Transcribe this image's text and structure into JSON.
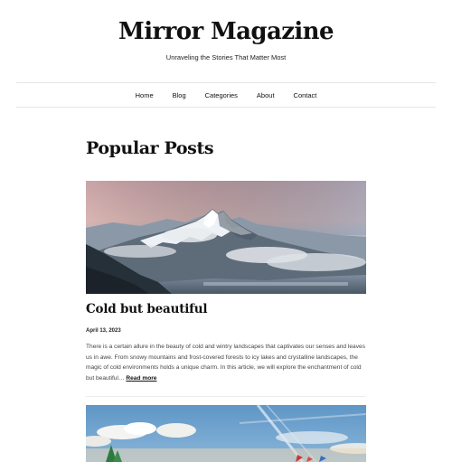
{
  "site": {
    "title": "Mirror Magazine",
    "tagline": "Unraveling the Stories That Matter Most"
  },
  "nav": {
    "items": [
      {
        "label": "Home"
      },
      {
        "label": "Blog"
      },
      {
        "label": "Categories"
      },
      {
        "label": "About"
      },
      {
        "label": "Contact"
      }
    ]
  },
  "main": {
    "section_title": "Popular Posts",
    "posts": [
      {
        "title": "Cold but beautiful",
        "date": "April 13, 2023",
        "excerpt": "There is a certain allure in the beauty of cold and wintry landscapes that captivates our senses and leaves us in awe. From snowy mountains and frost-covered forests to icy lakes and crystalline landscapes, the magic of cold environments holds a unique charm. In this article, we will explore the enchantment of cold but beautiful…",
        "read_more": "Read more",
        "image_icon": "snowy-mountain-photo"
      },
      {
        "image_icon": "sky-festival-photo"
      }
    ]
  },
  "colors": {
    "text": "#111111",
    "muted": "#444444",
    "border": "#e6e6e6"
  }
}
